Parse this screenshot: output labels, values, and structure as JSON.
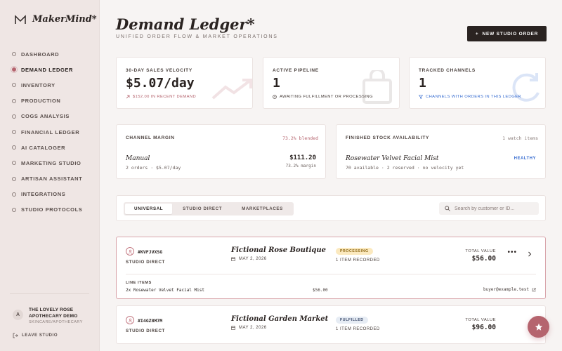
{
  "brand": {
    "name": "MakerMind*",
    "logo_icon": "maker-logo-icon"
  },
  "sidebar": {
    "items": [
      {
        "label": "DASHBOARD",
        "active": false
      },
      {
        "label": "DEMAND LEDGER",
        "active": true
      },
      {
        "label": "INVENTORY",
        "active": false
      },
      {
        "label": "PRODUCTION",
        "active": false
      },
      {
        "label": "COGS ANALYSIS",
        "active": false
      },
      {
        "label": "FINANCIAL LEDGER",
        "active": false
      },
      {
        "label": "AI CATALOGER",
        "active": false
      },
      {
        "label": "MARKETING STUDIO",
        "active": false
      },
      {
        "label": "ARTISAN ASSISTANT",
        "active": false
      },
      {
        "label": "INTEGRATIONS",
        "active": false
      },
      {
        "label": "STUDIO PROTOCOLS",
        "active": false
      }
    ],
    "user": {
      "initial": "A",
      "name": "THE LOVELY ROSE APOTHECARY DEMO",
      "category": "SKINCARE/APOTHECARY"
    },
    "leave_label": "LEAVE STUDIO"
  },
  "header": {
    "title": "Demand Ledger*",
    "subtitle": "UNIFIED ORDER FLOW & MARKET OPERATIONS",
    "new_order_label": "NEW STUDIO ORDER"
  },
  "kpis": {
    "velocity": {
      "label": "30-DAY SALES VELOCITY",
      "value": "$5.07/day",
      "note": "$152.00 IN RECENT DEMAND"
    },
    "pipeline": {
      "label": "ACTIVE PIPELINE",
      "value": "1",
      "note": "AWAITING FULFILLMENT OR PROCESSING"
    },
    "channels": {
      "label": "TRACKED CHANNELS",
      "value": "1",
      "note": "CHANNELS WITH ORDERS IN THIS LEDGER"
    }
  },
  "channel_margin": {
    "label": "CHANNEL MARGIN",
    "blended": "73.2% blended",
    "row": {
      "name": "Manual",
      "sub": "2 orders · $5.07/day",
      "value": "$111.20",
      "margin": "73.2% margin"
    }
  },
  "stock": {
    "label": "FINISHED STOCK AVAILABILITY",
    "watch": "1 watch items",
    "row": {
      "name": "Rosewater Velvet Facial Mist",
      "sub": "70 available · 2 reserved · no velocity yet",
      "status": "HEALTHY"
    }
  },
  "filters": {
    "tabs": [
      {
        "label": "UNIVERSAL",
        "active": true
      },
      {
        "label": "STUDIO DIRECT",
        "active": false
      },
      {
        "label": "MARKETPLACES",
        "active": false
      }
    ],
    "search_placeholder": "Search by customer or ID..."
  },
  "orders": [
    {
      "id": "#KVFJVXSG",
      "channel": "STUDIO DIRECT",
      "customer": "Fictional Rose Boutique",
      "date": "MAY 2, 2026",
      "status": "PROCESSING",
      "items_recorded": "1 ITEM RECORDED",
      "total_label": "TOTAL VALUE",
      "total": "$56.00",
      "line_items_label": "LINE ITEMS",
      "line_item": "2x Rosewater Velvet Facial Mist",
      "line_price": "$56.00",
      "email": "buyer@example.test"
    },
    {
      "id": "#I4GZ8M7M",
      "channel": "STUDIO DIRECT",
      "customer": "Fictional Garden Market",
      "date": "MAY 2, 2026",
      "status": "FULFILLED",
      "items_recorded": "1 ITEM RECORDED",
      "total_label": "TOTAL VALUE",
      "total": "$96.00"
    }
  ],
  "colors": {
    "accent": "#b5646e",
    "ink": "#2a2321",
    "link_blue": "#3b6fd1"
  }
}
